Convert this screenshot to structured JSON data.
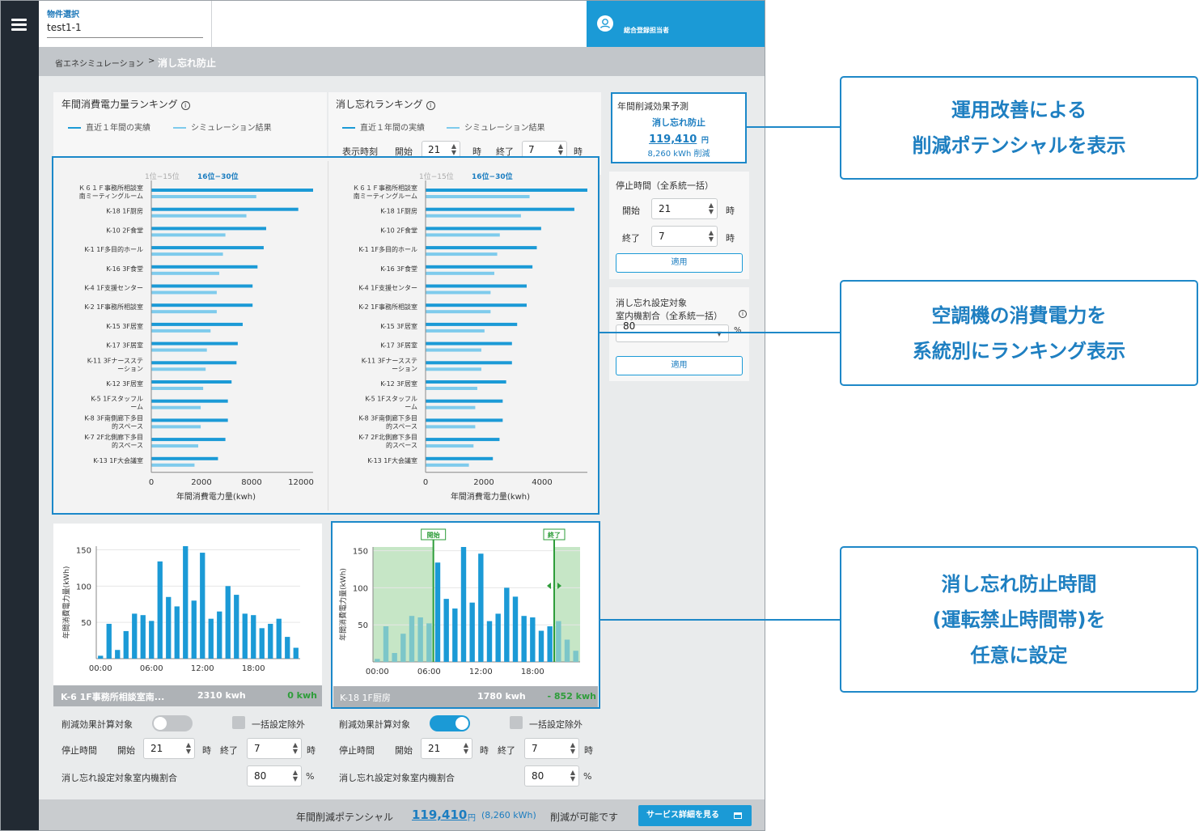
{
  "header": {
    "property_label": "物件選択",
    "property_value": "test1-1",
    "user_name": "総合登録担当者"
  },
  "breadcrumb": {
    "parent": "省エネシミュレーション",
    "separator": ">",
    "current": "消し忘れ防止"
  },
  "ranking_annual": {
    "title": "年間消費電力量ランキング",
    "info_icon": "info-icon",
    "legend_actual": "直近１年間の実績",
    "legend_sim": "シミュレーション結果"
  },
  "ranking_forgot": {
    "title": "消し忘れランキング",
    "info_icon": "info-icon",
    "legend_actual": "直近１年間の実績",
    "legend_sim": "シミュレーション結果",
    "display_time_label": "表示時刻",
    "start_label": "開始",
    "start_value": "21",
    "hour_unit": "時",
    "end_label": "終了",
    "end_value": "7"
  },
  "rank_tabs": {
    "tab1": "1位−15位",
    "tab2": "16位−30位"
  },
  "chart_data": [
    {
      "type": "bar",
      "orientation": "horizontal",
      "categories": [
        "Ｋ６１Ｆ事務所相談室南ミーティングルーム",
        "K-18 1F厨房",
        "K-10 2F食堂",
        "K-1 1F多目的ホール",
        "K-16 3F食堂",
        "K-4 1F支援センター",
        "K-2 1F事務所相談室",
        "K-15 3F居室",
        "K-17 3F居室",
        "K-11 3Fナースステーション",
        "K-12 3F居室",
        "K-5 1Fスタッフルーム",
        "K-8 3F南側廊下多目的スペース",
        "K-7 2F北側廊下多目的スペース",
        "K-13 1F大会議室"
      ],
      "series": [
        {
          "name": "直近１年間の実績",
          "values": [
            13100,
            11900,
            9300,
            9100,
            8600,
            8200,
            8200,
            7400,
            7000,
            6900,
            6500,
            6200,
            6200,
            6000,
            5400
          ]
        },
        {
          "name": "シミュレーション結果",
          "values": [
            8500,
            7700,
            6000,
            5800,
            5500,
            5300,
            5300,
            4800,
            4500,
            4400,
            4200,
            4000,
            4000,
            3800,
            3500
          ]
        }
      ],
      "xlabel": "年間消費電力量(kwh)",
      "xlim": [
        0,
        13100
      ],
      "xticks": [
        "0",
        "2000",
        "8000",
        "12000"
      ]
    },
    {
      "type": "bar",
      "orientation": "horizontal",
      "categories": [
        "Ｋ６１Ｆ事務所相談室南ミーティングルーム",
        "K-18 1F厨房",
        "K-10 2F食堂",
        "K-1 1F多目的ホール",
        "K-16 3F食堂",
        "K-4 1F支援センター",
        "K-2 1F事務所相談室",
        "K-15 3F居室",
        "K-17 3F居室",
        "K-11 3Fナースステーション",
        "K-12 3F居室",
        "K-5 1Fスタッフルーム",
        "K-8 3F南側廊下多目的スペース",
        "K-7 2F北側廊下多目的スペース",
        "K-13 1F大会議室"
      ],
      "series": [
        {
          "name": "直近１年間の実績",
          "values": [
            5600,
            5150,
            4000,
            3850,
            3700,
            3500,
            3500,
            3170,
            2990,
            2990,
            2790,
            2670,
            2670,
            2560,
            2330
          ]
        },
        {
          "name": "シミュレーション結果",
          "values": [
            3600,
            3300,
            2570,
            2480,
            2380,
            2250,
            2250,
            2040,
            1930,
            1930,
            1790,
            1720,
            1720,
            1660,
            1500
          ]
        }
      ],
      "xlabel": "年間消費電力量(kwh)",
      "xlim": [
        0,
        5600
      ],
      "xticks": [
        "0",
        "2000",
        "4000"
      ]
    },
    {
      "type": "bar",
      "categories": [
        "00:00",
        "01:00",
        "02:00",
        "03:00",
        "04:00",
        "05:00",
        "06:00",
        "07:00",
        "08:00",
        "09:00",
        "10:00",
        "11:00",
        "12:00",
        "13:00",
        "14:00",
        "15:00",
        "16:00",
        "17:00",
        "18:00",
        "19:00",
        "20:00",
        "21:00",
        "22:00",
        "23:00"
      ],
      "values": [
        4,
        48,
        12,
        38,
        62,
        60,
        52,
        134,
        85,
        72,
        155,
        80,
        146,
        55,
        65,
        100,
        88,
        62,
        60,
        42,
        48,
        55,
        30,
        15
      ],
      "ylabel": "年間消費電力量(kWh)",
      "ylim": [
        0,
        155
      ],
      "yticks": [
        "50",
        "100",
        "150"
      ],
      "xticks": [
        "00:00",
        "06:00",
        "12:00",
        "18:00"
      ]
    },
    {
      "type": "bar",
      "categories": [
        "00:00",
        "01:00",
        "02:00",
        "03:00",
        "04:00",
        "05:00",
        "06:00",
        "07:00",
        "08:00",
        "09:00",
        "10:00",
        "11:00",
        "12:00",
        "13:00",
        "14:00",
        "15:00",
        "16:00",
        "17:00",
        "18:00",
        "19:00",
        "20:00",
        "21:00",
        "22:00",
        "23:00"
      ],
      "values": [
        4,
        48,
        12,
        38,
        62,
        60,
        52,
        134,
        85,
        72,
        155,
        80,
        146,
        55,
        65,
        100,
        88,
        62,
        60,
        42,
        48,
        55,
        30,
        15
      ],
      "ylabel": "年間消費電力量(kWh)",
      "ylim": [
        0,
        155
      ],
      "yticks": [
        "50",
        "100",
        "150"
      ],
      "xticks": [
        "00:00",
        "06:00",
        "12:00",
        "18:00"
      ],
      "start_marker": "開始",
      "end_marker": "終了",
      "stop_start_hour": 7,
      "stop_end_hour": 21
    }
  ],
  "unit_left": {
    "name": "K-6 1F事務所相談室南...",
    "energy": "2310 kwh",
    "saving": "0 kwh",
    "calc_target_label": "削減効果計算対象",
    "exclude_label": "一括設定除外",
    "stop_time_label": "停止時間",
    "start_label": "開始",
    "start_value": "21",
    "hour_unit": "時",
    "end_label": "終了",
    "end_value": "7",
    "ratio_label": "消し忘れ設定対象室内機割合",
    "ratio_value": "80",
    "percent": "%"
  },
  "unit_right": {
    "name": "K-18 1F厨房",
    "energy": "1780 kwh",
    "saving": "- 852 kwh",
    "calc_target_label": "削減効果計算対象",
    "exclude_label": "一括設定除外",
    "stop_time_label": "停止時間",
    "start_label": "開始",
    "start_value": "21",
    "hour_unit": "時",
    "end_label": "終了",
    "end_value": "7",
    "ratio_label": "消し忘れ設定対象室内機割合",
    "ratio_value": "80",
    "percent": "%"
  },
  "effect": {
    "title": "年間削減効果予測",
    "subtitle": "消し忘れ防止",
    "amount": "119,410",
    "yen": "円",
    "kwh": "8,260 kWh 削減"
  },
  "stop_panel": {
    "title": "停止時間（全系統一括）",
    "start_label": "開始",
    "start_value": "21",
    "end_label": "終了",
    "end_value": "7",
    "hour_unit": "時",
    "apply_label": "適用"
  },
  "ratio_panel": {
    "title_line1": "消し忘れ設定対象",
    "title_line2": "室内機割合（全系統一括）",
    "value": "80",
    "percent": "%",
    "apply_label": "適用"
  },
  "footer": {
    "label": "年間削減ポテンシャル",
    "amount": "119,410",
    "yen": "円",
    "kwh": "(8,260 kWh)",
    "suffix": "削減が可能です",
    "button_label": "サービス詳細を見る"
  },
  "callouts": {
    "c1_line1": "運用改善による",
    "c1_line2": "削減ポテンシャルを表示",
    "c2_line1": "空調機の消費電力を",
    "c2_line2": "系統別にランキング表示",
    "c3_line1": "消し忘れ防止時間",
    "c3_line2": "(運転禁止時間帯)を",
    "c3_line3": "任意に設定"
  },
  "colors": {
    "actual": "#1b9ad6",
    "simulation": "#7ecbec",
    "accent": "#1b9ad6",
    "saving_green": "#2e9d3a",
    "stop_zone": "#c6e6c6"
  }
}
